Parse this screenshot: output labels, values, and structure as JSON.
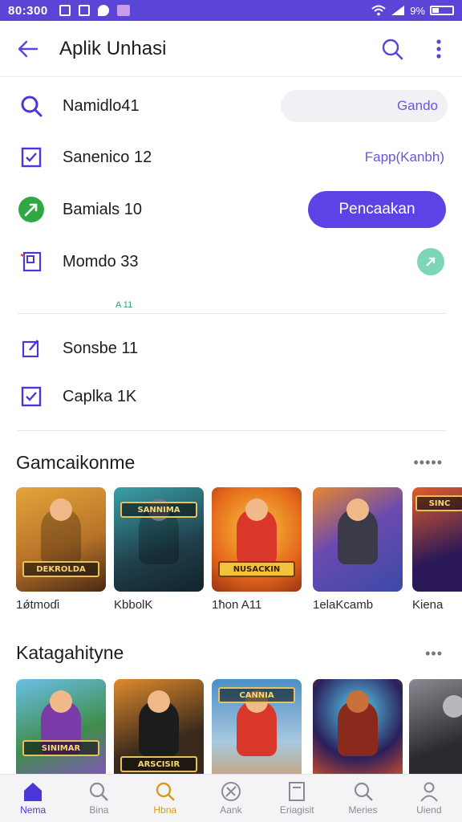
{
  "status_bar": {
    "time": "80:300",
    "right_text": "9%",
    "battery_text": ""
  },
  "app_bar": {
    "title": "Aplik Unhasi"
  },
  "settings": [
    {
      "label": "Namidlo41",
      "control": "input",
      "value": "Gando"
    },
    {
      "label": "Sanenico 12",
      "control": "link",
      "value": "Fapp(Kanbh)"
    },
    {
      "label": "Bamials 10",
      "control": "button",
      "value": "Pencaakan"
    },
    {
      "label": "Momdo 33",
      "control": "dot",
      "value": ""
    }
  ],
  "section_tag": "A 11",
  "settings2": [
    {
      "label": "Sonsbe 11"
    },
    {
      "label": "Caplka 1K"
    }
  ],
  "games": {
    "title": "Gamcaikonme",
    "more": "•••••",
    "items": [
      {
        "caption": "1ǿtmoɗi",
        "banner": "DEKROLDA",
        "bg": "#b9742a",
        "accent": "#e3a53a"
      },
      {
        "caption": "KbbolK",
        "banner": "SANNIMA",
        "bg": "#1f3f4a",
        "accent": "#3aa0a8"
      },
      {
        "caption": "1ħon A11",
        "banner": "NUSACKIN",
        "bg": "#e66a1c",
        "accent": "#f7c43a"
      },
      {
        "caption": "1elaKcamb",
        "banner": "",
        "bg": "#3b4aa8",
        "accent": "#e7872d"
      },
      {
        "caption": "Kiena",
        "banner": "SINC",
        "bg": "#2a1858",
        "accent": "#e25c2a"
      }
    ]
  },
  "categories": {
    "title": "Katagahityne",
    "more": "•••",
    "items": [
      {
        "banner": "SINIMAR",
        "bg": "#3f8c4a",
        "accent": "#8a4fc6"
      },
      {
        "banner": "ARSCISIR",
        "bg": "#3a2a1c",
        "accent": "#e08a2c"
      },
      {
        "banner": "CANNIA",
        "bg": "#4a8fc8",
        "accent": "#e5c46a"
      },
      {
        "banner": "",
        "bg": "#2a1f5a",
        "accent": "#e3542a"
      },
      {
        "banner": "",
        "bg": "#2a2a2e",
        "accent": "#8a8a92"
      }
    ]
  },
  "bottom_nav": [
    {
      "label": "Nema",
      "icon": "home-icon",
      "state": "active"
    },
    {
      "label": "Bina",
      "icon": "search-icon",
      "state": ""
    },
    {
      "label": "Hbna",
      "icon": "search-icon",
      "state": "accent"
    },
    {
      "label": "Aank",
      "icon": "compass-icon",
      "state": ""
    },
    {
      "label": "Eriagisit",
      "icon": "book-icon",
      "state": ""
    },
    {
      "label": "Meries",
      "icon": "search-icon",
      "state": ""
    },
    {
      "label": "Uiend",
      "icon": "person-icon",
      "state": ""
    }
  ],
  "colors": {
    "brand": "#5b45d6",
    "primary_button": "#5c43e6",
    "link": "#6a56d8"
  }
}
